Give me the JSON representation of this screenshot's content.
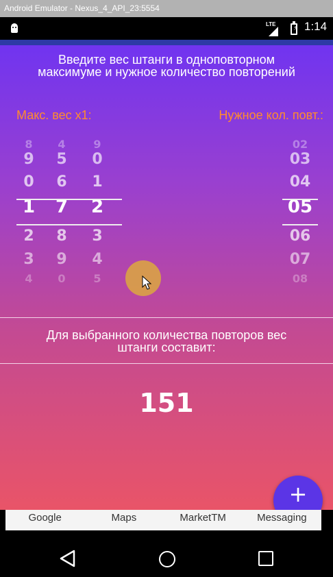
{
  "window": {
    "title": "Android Emulator - Nexus_4_API_23:5554"
  },
  "statusbar": {
    "network": "LTE",
    "time": "1:14"
  },
  "app": {
    "headline_line1": "Введите вес штанги в одноповторном",
    "headline_line2": "максимуме и нужное количество повторений",
    "label_max_weight": "Макс. вес x1:",
    "label_reps": "Нужное кол. повт.:",
    "weight_picker": {
      "columns": [
        [
          "8",
          "9",
          "0",
          "1",
          "2",
          "3",
          "4"
        ],
        [
          "4",
          "5",
          "6",
          "7",
          "8",
          "9",
          "0"
        ],
        [
          "9",
          "0",
          "1",
          "2",
          "3",
          "4",
          "5"
        ]
      ],
      "selected": [
        "1",
        "7",
        "2"
      ]
    },
    "reps_picker": {
      "values": [
        "02",
        "03",
        "04",
        "05",
        "06",
        "07",
        "08"
      ],
      "selected": "05"
    },
    "result_label_line1": "Для выбранного количества повторов вес",
    "result_label_line2": "штанги составит:",
    "result_value": "151",
    "fab_symbol": "+"
  },
  "dock": {
    "items": [
      "Google",
      "Maps",
      "MarketTM",
      "Messaging"
    ]
  },
  "icons": {
    "status_left": "android-icon",
    "nav": [
      "back-icon",
      "home-icon",
      "recent-apps-icon"
    ]
  },
  "colors": {
    "accent_label": "#ff8c2e",
    "fab": "#5b35e6",
    "gradient_top": "#7034f0",
    "gradient_bottom": "#e95468"
  }
}
